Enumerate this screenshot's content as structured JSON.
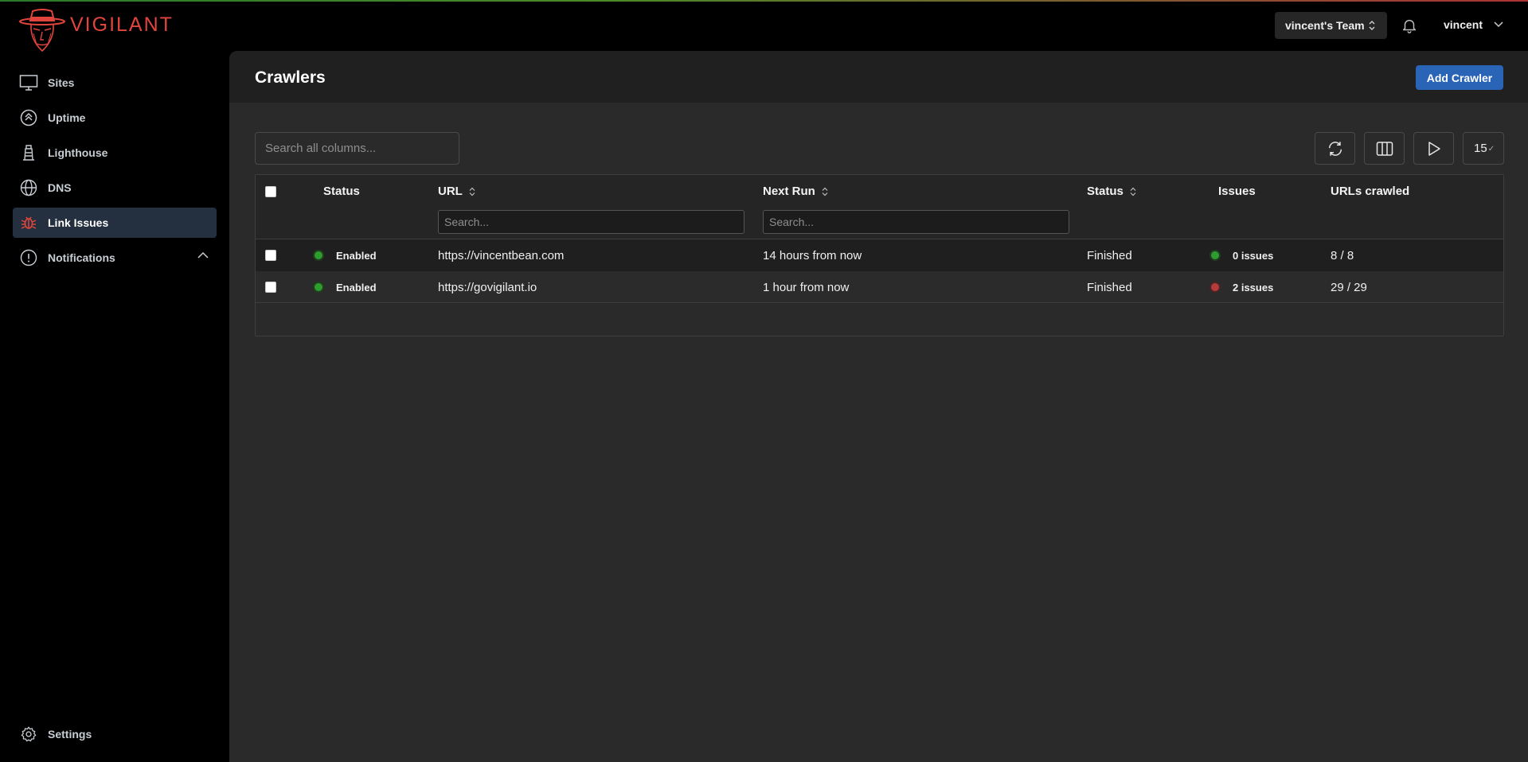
{
  "brand": {
    "name": "VIGILANT"
  },
  "header": {
    "team": "vincent's Team",
    "user": "vincent"
  },
  "sidebar": {
    "items": [
      {
        "label": "Sites",
        "icon": "monitor-icon",
        "active": false
      },
      {
        "label": "Uptime",
        "icon": "uptime-icon",
        "active": false
      },
      {
        "label": "Lighthouse",
        "icon": "lighthouse-icon",
        "active": false
      },
      {
        "label": "DNS",
        "icon": "globe-icon",
        "active": false
      },
      {
        "label": "Link Issues",
        "icon": "bug-icon",
        "active": true
      },
      {
        "label": "Notifications",
        "icon": "alert-circle-icon",
        "active": false,
        "expanded": true
      }
    ],
    "settings": "Settings"
  },
  "page": {
    "title": "Crawlers",
    "add_button": "Add Crawler",
    "search_placeholder": "Search all columns...",
    "page_size": "15"
  },
  "table": {
    "columns": [
      "Status",
      "URL",
      "Next Run",
      "Status",
      "Issues",
      "URLs crawled"
    ],
    "column_search_placeholder": "Search...",
    "rows": [
      {
        "enabled": "Enabled",
        "url": "https://vincentbean.com",
        "next_run": "14 hours from now",
        "status": "Finished",
        "issues": "0 issues",
        "issues_color": "green",
        "crawled": "8 / 8"
      },
      {
        "enabled": "Enabled",
        "url": "https://govigilant.io",
        "next_run": "1 hour from now",
        "status": "Finished",
        "issues": "2 issues",
        "issues_color": "red",
        "crawled": "29 / 29"
      }
    ]
  },
  "colors": {
    "accent": "#2a64b7",
    "brand": "#e0453d",
    "status_ok": "#2f9c2f",
    "status_error": "#b63b3b"
  }
}
